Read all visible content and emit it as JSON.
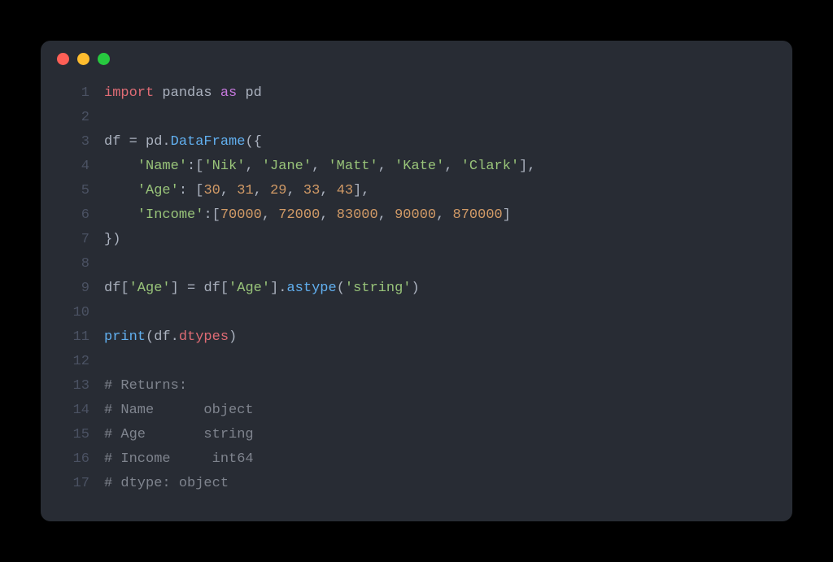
{
  "window": {
    "dots": [
      "red",
      "yellow",
      "green"
    ]
  },
  "code": {
    "lines": [
      {
        "n": "1",
        "tokens": [
          [
            "kw-import",
            "import"
          ],
          [
            "",
            null
          ],
          [
            "mod",
            "pandas"
          ],
          [
            "",
            null
          ],
          [
            "kw-as",
            "as"
          ],
          [
            "",
            null
          ],
          [
            "mod",
            "pd"
          ]
        ]
      },
      {
        "n": "2",
        "tokens": []
      },
      {
        "n": "3",
        "tokens": [
          [
            "var",
            "df "
          ],
          [
            "op",
            "="
          ],
          [
            "",
            null
          ],
          [
            "var",
            "pd"
          ],
          [
            "punct",
            "."
          ],
          [
            "func",
            "DataFrame"
          ],
          [
            "punct",
            "({"
          ]
        ]
      },
      {
        "n": "4",
        "tokens": [
          [
            "",
            "    "
          ],
          [
            "str",
            "'Name'"
          ],
          [
            "punct",
            ":["
          ],
          [
            "str",
            "'Nik'"
          ],
          [
            "punct",
            ", "
          ],
          [
            "str",
            "'Jane'"
          ],
          [
            "punct",
            ", "
          ],
          [
            "str",
            "'Matt'"
          ],
          [
            "punct",
            ", "
          ],
          [
            "str",
            "'Kate'"
          ],
          [
            "punct",
            ", "
          ],
          [
            "str",
            "'Clark'"
          ],
          [
            "punct",
            "],"
          ]
        ]
      },
      {
        "n": "5",
        "tokens": [
          [
            "",
            "    "
          ],
          [
            "str",
            "'Age'"
          ],
          [
            "punct",
            ": ["
          ],
          [
            "num",
            "30"
          ],
          [
            "punct",
            ", "
          ],
          [
            "num",
            "31"
          ],
          [
            "punct",
            ", "
          ],
          [
            "num",
            "29"
          ],
          [
            "punct",
            ", "
          ],
          [
            "num",
            "33"
          ],
          [
            "punct",
            ", "
          ],
          [
            "num",
            "43"
          ],
          [
            "punct",
            "],"
          ]
        ]
      },
      {
        "n": "6",
        "tokens": [
          [
            "",
            "    "
          ],
          [
            "str",
            "'Income'"
          ],
          [
            "punct",
            ":["
          ],
          [
            "num",
            "70000"
          ],
          [
            "punct",
            ", "
          ],
          [
            "num",
            "72000"
          ],
          [
            "punct",
            ", "
          ],
          [
            "num",
            "83000"
          ],
          [
            "punct",
            ", "
          ],
          [
            "num",
            "90000"
          ],
          [
            "punct",
            ", "
          ],
          [
            "num",
            "870000"
          ],
          [
            "punct",
            "]"
          ]
        ]
      },
      {
        "n": "7",
        "tokens": [
          [
            "punct",
            "})"
          ]
        ]
      },
      {
        "n": "8",
        "tokens": []
      },
      {
        "n": "9",
        "tokens": [
          [
            "var",
            "df"
          ],
          [
            "punct",
            "["
          ],
          [
            "str",
            "'Age'"
          ],
          [
            "punct",
            "] "
          ],
          [
            "op",
            "="
          ],
          [
            "",
            null
          ],
          [
            "var",
            "df"
          ],
          [
            "punct",
            "["
          ],
          [
            "str",
            "'Age'"
          ],
          [
            "punct",
            "]."
          ],
          [
            "func",
            "astype"
          ],
          [
            "punct",
            "("
          ],
          [
            "str",
            "'string'"
          ],
          [
            "punct",
            ")"
          ]
        ]
      },
      {
        "n": "10",
        "tokens": []
      },
      {
        "n": "11",
        "tokens": [
          [
            "builtin",
            "print"
          ],
          [
            "punct",
            "("
          ],
          [
            "var",
            "df"
          ],
          [
            "punct",
            "."
          ],
          [
            "attr",
            "dtypes"
          ],
          [
            "punct",
            ")"
          ]
        ]
      },
      {
        "n": "12",
        "tokens": []
      },
      {
        "n": "13",
        "tokens": [
          [
            "comment",
            "# Returns:"
          ]
        ]
      },
      {
        "n": "14",
        "tokens": [
          [
            "comment",
            "# Name      object"
          ]
        ]
      },
      {
        "n": "15",
        "tokens": [
          [
            "comment",
            "# Age       string"
          ]
        ]
      },
      {
        "n": "16",
        "tokens": [
          [
            "comment",
            "# Income     int64"
          ]
        ]
      },
      {
        "n": "17",
        "tokens": [
          [
            "comment",
            "# dtype: object"
          ]
        ]
      }
    ]
  }
}
